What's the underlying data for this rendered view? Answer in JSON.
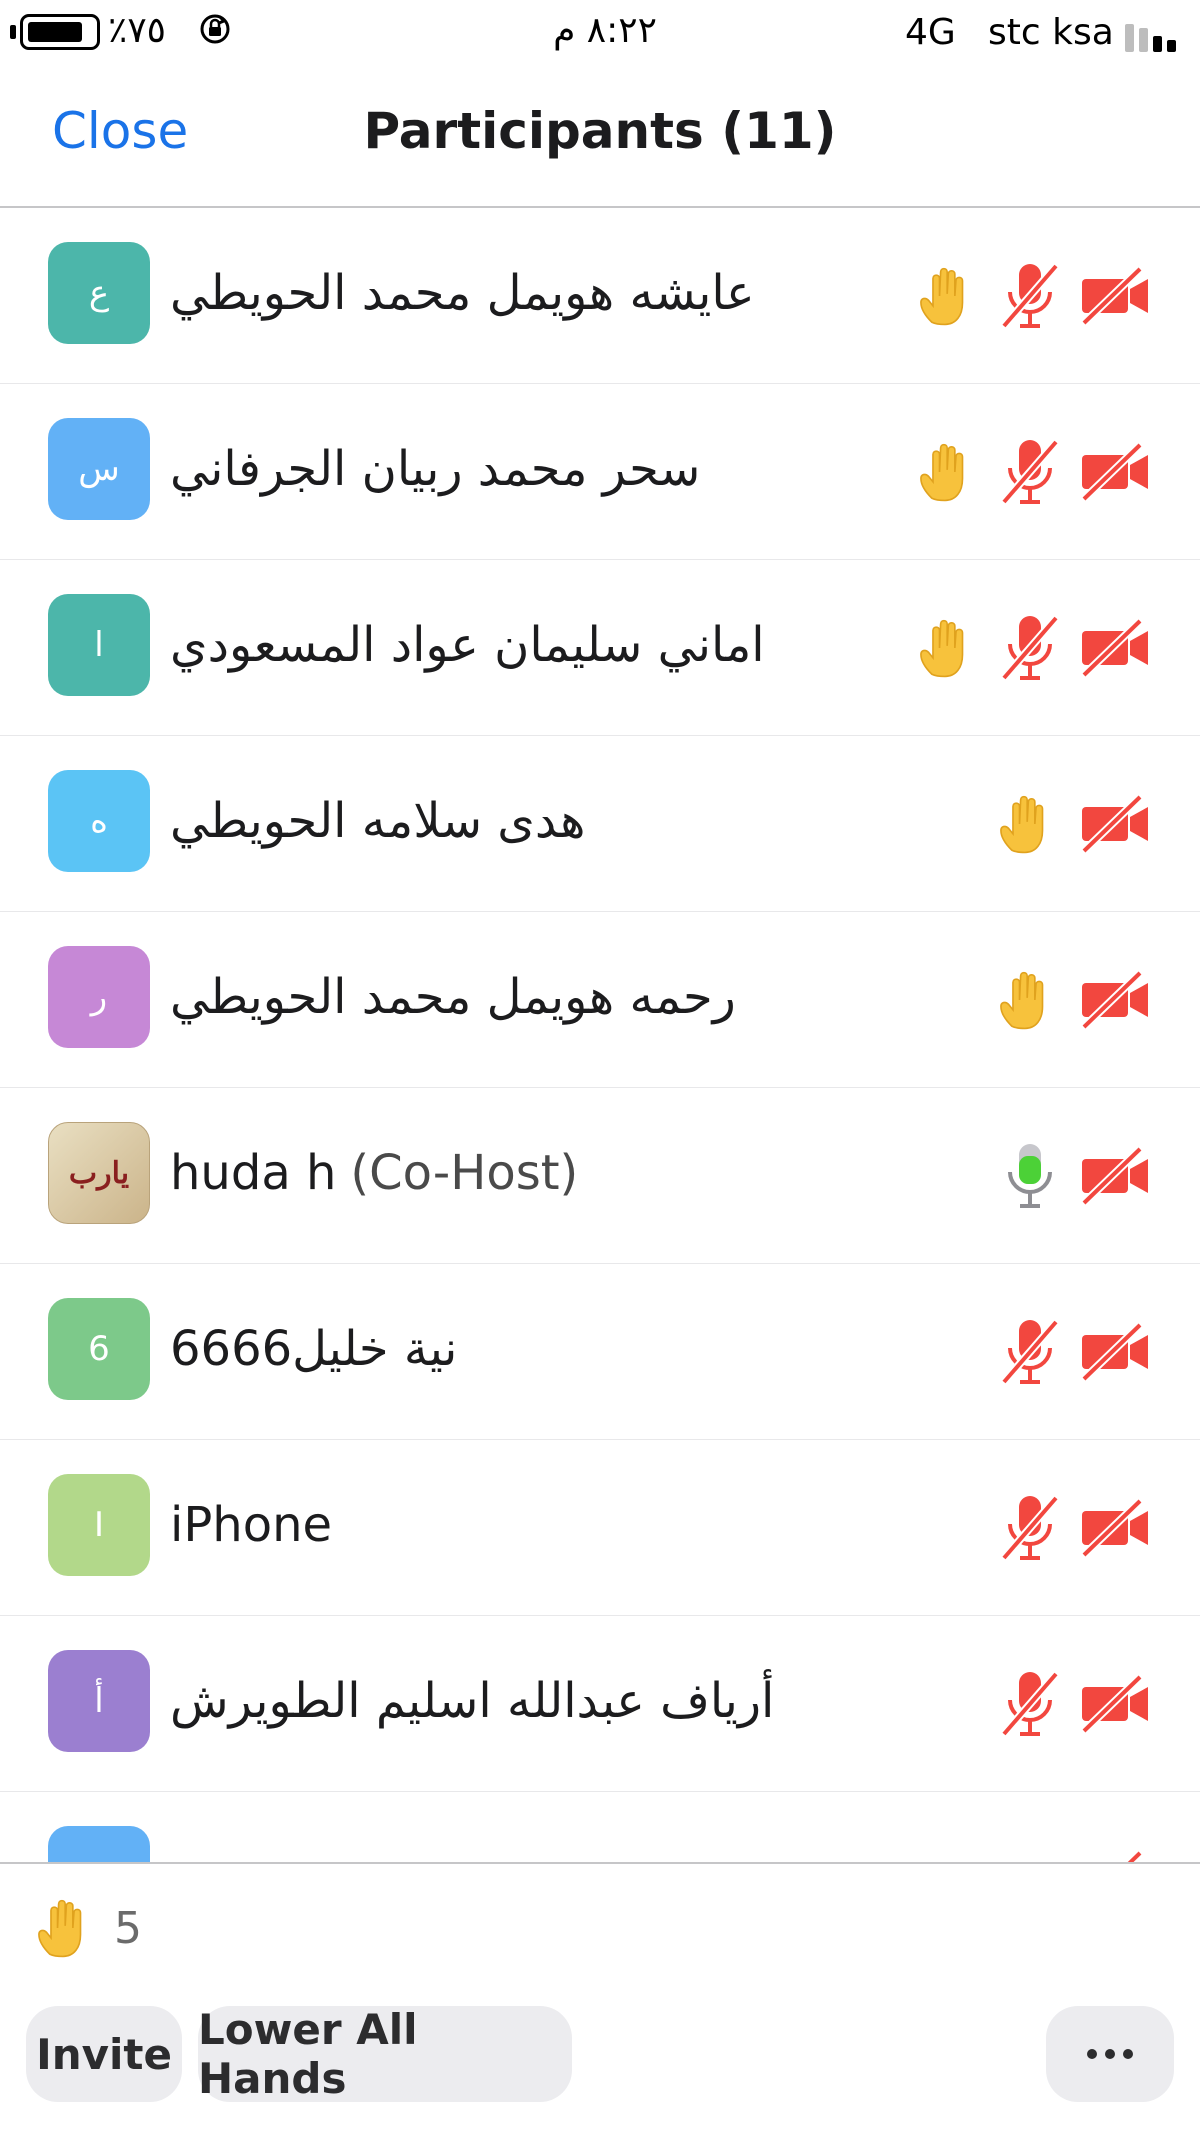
{
  "status_bar": {
    "battery_percent": "٪٧٥",
    "time": "٨:٢٢ م",
    "network": "4G",
    "carrier": "stc ksa"
  },
  "header": {
    "close_label": "Close",
    "title": "Participants (11)"
  },
  "participants": [
    {
      "initial": "ع",
      "name": "عايشه هويمل  محمد الحويطي",
      "avatar_color": "#4cb6aa",
      "raised_hand": true,
      "mic": "muted",
      "video": "off"
    },
    {
      "initial": "س",
      "name": "سحر محمد ربيان الجرفاني",
      "avatar_color": "#62b1f6",
      "raised_hand": true,
      "mic": "muted",
      "video": "off"
    },
    {
      "initial": "ا",
      "name": "اماني سليمان عواد المسعودي",
      "avatar_color": "#4cb6aa",
      "raised_hand": true,
      "mic": "muted",
      "video": "off"
    },
    {
      "initial": "ه",
      "name": "هدى سلامه الحويطي",
      "avatar_color": "#5bc4f5",
      "raised_hand": true,
      "mic": "none",
      "video": "off"
    },
    {
      "initial": "ر",
      "name": "رحمه هويمل محمد الحويطي",
      "avatar_color": "#c688d6",
      "raised_hand": true,
      "mic": "none",
      "video": "off"
    },
    {
      "initial": "",
      "name": "huda h",
      "role": "(Co-Host)",
      "avatar_color": "#d9c89f",
      "avatar_image": true,
      "avatar_text": "يارب",
      "raised_hand": false,
      "mic": "on",
      "video": "off"
    },
    {
      "initial": "6",
      "name": "6666نية خليل",
      "avatar_color": "#7dc98a",
      "raised_hand": false,
      "mic": "muted",
      "video": "off"
    },
    {
      "initial": "I",
      "name": "iPhone",
      "avatar_color": "#b2d88a",
      "raised_hand": false,
      "mic": "muted",
      "video": "off"
    },
    {
      "initial": "أ",
      "name": "أرياف عبدالله اسليم الطويرش",
      "avatar_color": "#9b7fd0",
      "raised_hand": false,
      "mic": "muted",
      "video": "off"
    },
    {
      "initial": "",
      "name": "",
      "avatar_color": "#62b1f6",
      "raised_hand": false,
      "mic": "none",
      "video": "off"
    }
  ],
  "footer": {
    "raised_hands_count": "5",
    "invite_label": "Invite",
    "lower_all_label": "Lower All Hands"
  },
  "colors": {
    "accent": "#1a73e8",
    "muted_red": "#f2473f",
    "mic_on_green": "#4cd137",
    "hand_yellow": "#f7c23c"
  }
}
